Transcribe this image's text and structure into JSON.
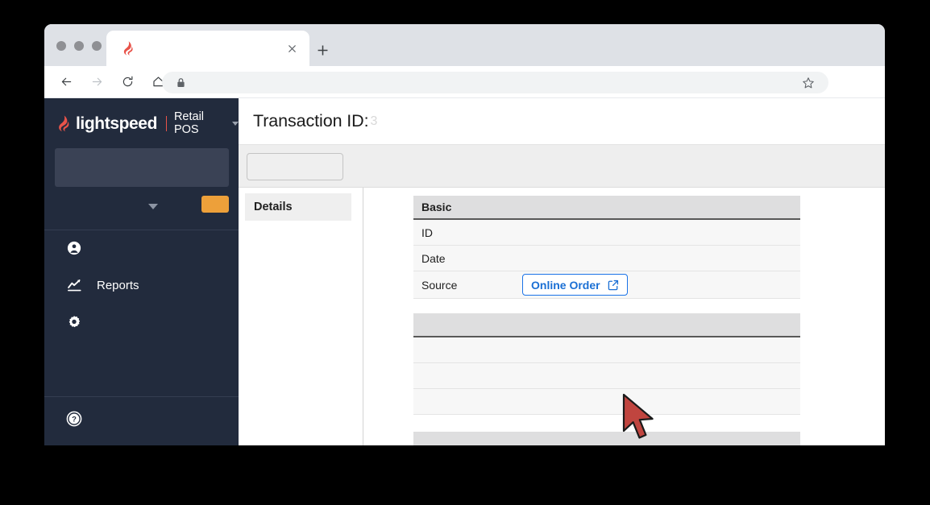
{
  "browser": {
    "traffic_lights": [
      "close",
      "minimize",
      "maximize"
    ],
    "tab": {
      "title": "",
      "favicon": "lightspeed-flame",
      "close_label": "×"
    },
    "new_tab_label": "+",
    "toolbar": {
      "back": "←",
      "forward": "→",
      "reload": "⟳",
      "home": "⌂",
      "lock": "lock-icon",
      "address_value": "",
      "address_placeholder": "",
      "bookmark": "star-icon"
    }
  },
  "sidebar": {
    "brand": {
      "wordmark": "lightspeed",
      "product": "Retail POS",
      "caret": "▾"
    },
    "search": {
      "value": "",
      "placeholder": ""
    },
    "filter": {
      "selected": "",
      "action_button_label": ""
    },
    "items": [
      {
        "label": "",
        "icon": "user-icon"
      },
      {
        "label": "Reports",
        "icon": "chart-line-icon"
      },
      {
        "label": "",
        "icon": "gear-icon"
      }
    ],
    "help": {
      "label": "",
      "icon": "help-circle-icon"
    }
  },
  "header": {
    "title": "Transaction ID:",
    "title_trailing": "3"
  },
  "subbar": {
    "button_label": ""
  },
  "left_pane": {
    "tab_label": "Details"
  },
  "cards": [
    {
      "title": "Basic",
      "rows": [
        {
          "label": "ID",
          "value": "",
          "type": "text"
        },
        {
          "label": "Date",
          "value": "",
          "type": "text"
        },
        {
          "label": "Source",
          "value": "Online Order",
          "type": "link",
          "icon": "external-link-icon"
        }
      ]
    },
    {
      "title": "",
      "rows": [
        {
          "label": "",
          "value": "",
          "type": "text"
        },
        {
          "label": "",
          "value": "",
          "type": "text"
        },
        {
          "label": "",
          "value": "",
          "type": "text"
        }
      ]
    },
    {
      "title": "",
      "rows": []
    }
  ],
  "cursor": {
    "type": "arrow-pointer",
    "color": "#c0453f"
  },
  "colors": {
    "sidebar_bg": "#222b3d",
    "brand_red": "#e8534a",
    "accent_orange": "#eda03a",
    "link_blue": "#1a73e8",
    "card_header_bg": "#dededf",
    "cursor_red": "#c0453f"
  }
}
